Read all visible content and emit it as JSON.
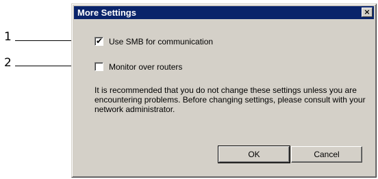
{
  "callouts": [
    {
      "number": "1"
    },
    {
      "number": "2"
    }
  ],
  "dialog": {
    "title": "More Settings",
    "close_glyph": "×",
    "options": [
      {
        "label": "Use SMB for communication",
        "checked": true
      },
      {
        "label": "Monitor over routers",
        "checked": false
      }
    ],
    "info_text": "It is recommended that you do not change these settings unless you are encountering problems. Before changing settings, please consult with your network administrator.",
    "buttons": {
      "ok_label": "OK",
      "cancel_label": "Cancel"
    }
  },
  "colors": {
    "titlebar": "#0a246a",
    "face": "#d4d0c8"
  },
  "icons": {
    "close": "close-icon",
    "check": "checkmark-icon"
  }
}
